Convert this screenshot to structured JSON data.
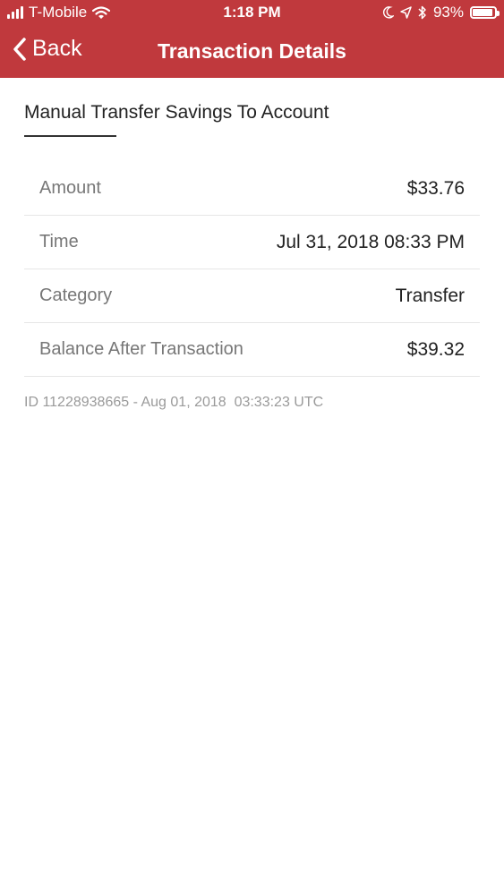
{
  "status_bar": {
    "carrier": "T-Mobile",
    "time": "1:18 PM",
    "battery_percent": "93%",
    "battery_level": 0.93
  },
  "nav": {
    "back_label": "Back",
    "title": "Transaction Details"
  },
  "transaction": {
    "description": "Manual Transfer Savings To Account",
    "rows": [
      {
        "label": "Amount",
        "value": "$33.76"
      },
      {
        "label": "Time",
        "value": "Jul 31, 2018 08:33 PM"
      },
      {
        "label": "Category",
        "value": "Transfer"
      },
      {
        "label": "Balance After Transaction",
        "value": "$39.32"
      }
    ],
    "meta": "ID 11228938665 - Aug 01, 2018  03:33:23 UTC"
  },
  "colors": {
    "header_bg": "#c0393d",
    "text_dark": "#222222",
    "label_gray": "#777777",
    "meta_gray": "#9a9a9a"
  },
  "icons": [
    "signal-icon",
    "wifi-icon",
    "moon-icon",
    "location-icon",
    "bluetooth-icon",
    "battery-icon",
    "chevron-left-icon"
  ]
}
